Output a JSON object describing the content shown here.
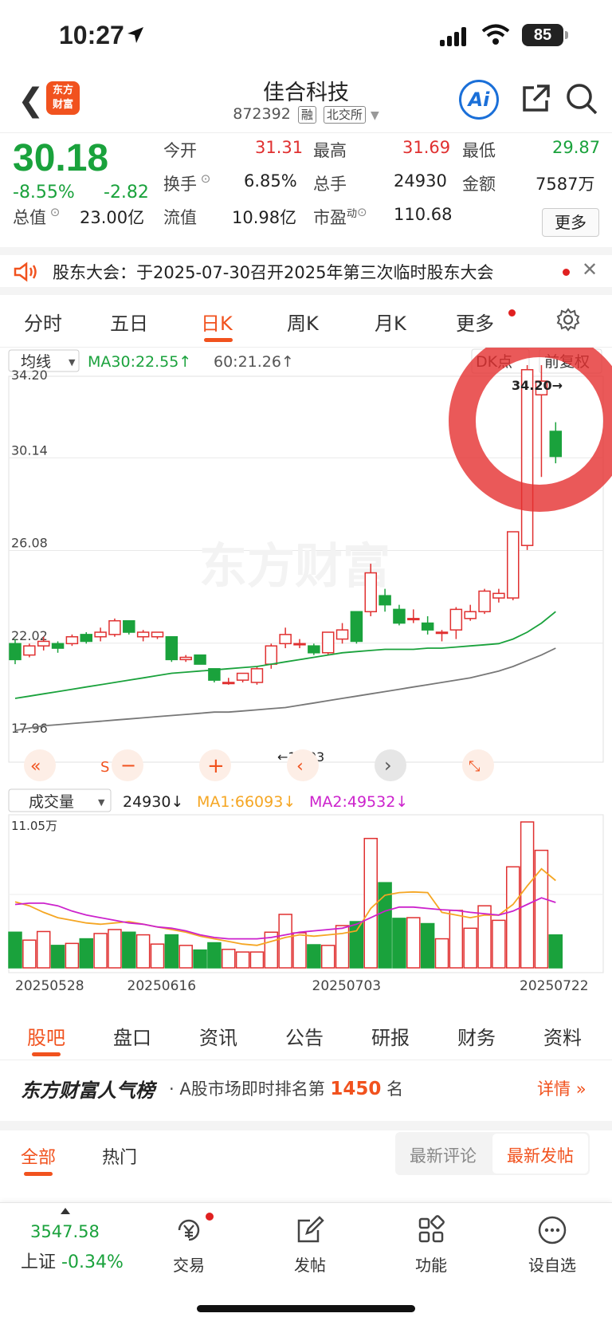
{
  "status_bar": {
    "time": "10:27",
    "battery": "85"
  },
  "header": {
    "logo_line1": "东方",
    "logo_line2": "财富",
    "title": "佳合科技",
    "code": "872392",
    "tag_margin": "融",
    "tag_exchange": "北交所"
  },
  "quote": {
    "price": "30.18",
    "change_pct": "-8.55%",
    "change": "-2.82",
    "open_label": "今开",
    "open": "31.31",
    "high_label": "最高",
    "high": "31.69",
    "low_label": "最低",
    "low": "29.87",
    "turnover_label": "换手",
    "turnover": "6.85%",
    "volume_label": "总手",
    "volume": "24930",
    "amount_label": "金额",
    "amount": "7587万",
    "mktcap_label": "总值",
    "mktcap": "23.00亿",
    "float_label": "流值",
    "float": "10.98亿",
    "pe_label": "市盈",
    "pe_sup": "动",
    "pe": "110.68",
    "more_label": "更多"
  },
  "notice": {
    "text": "股东大会：于2025-07-30召开2025年第三次临时股东大会"
  },
  "chart_tabs": [
    "分时",
    "五日",
    "日K",
    "周K",
    "月K",
    "更多"
  ],
  "active_chart_tab": "日K",
  "colors": {
    "up": "#e03030",
    "down": "#1aa23c",
    "accent": "#f1521e",
    "ma30": "#1aa23c",
    "ma60": "#777777",
    "vol_ma1": "#f5a623",
    "vol_ma2": "#cc22cc"
  },
  "kline": {
    "ma_selector": "均线",
    "ma30_label": "MA30:22.55↑",
    "ma60_label": "60:21.26↑",
    "dk_label": "DK点",
    "adjust_label": "前复权",
    "watermark": "东方财富",
    "y_ticks": [
      "34.20",
      "30.14",
      "26.08",
      "22.02",
      "17.96"
    ],
    "max_annotation": "34.20→",
    "min_annotation": "←19.03"
  },
  "volume_panel": {
    "selector": "成交量",
    "vol_label": "24930↓",
    "ma1_label": "MA1:66093↓",
    "ma2_label": "MA2:49532↓",
    "top_tick": "11.05万",
    "date_ticks": [
      "20250528",
      "20250616",
      "20250703",
      "20250722"
    ]
  },
  "chart_data": {
    "type": "candlestick",
    "ylim": [
      17.96,
      34.2
    ],
    "candles": [
      {
        "o": 22.0,
        "h": 22.2,
        "l": 21.1,
        "c": 21.3
      },
      {
        "o": 21.5,
        "h": 22.0,
        "l": 21.4,
        "c": 21.9
      },
      {
        "o": 21.9,
        "h": 22.3,
        "l": 21.7,
        "c": 22.1
      },
      {
        "o": 22.0,
        "h": 22.1,
        "l": 21.6,
        "c": 21.8
      },
      {
        "o": 22.0,
        "h": 22.4,
        "l": 21.9,
        "c": 22.3
      },
      {
        "o": 22.4,
        "h": 22.5,
        "l": 22.0,
        "c": 22.1
      },
      {
        "o": 22.3,
        "h": 22.7,
        "l": 22.1,
        "c": 22.5
      },
      {
        "o": 22.4,
        "h": 23.1,
        "l": 22.3,
        "c": 23.0
      },
      {
        "o": 23.0,
        "h": 23.0,
        "l": 22.4,
        "c": 22.5
      },
      {
        "o": 22.3,
        "h": 22.6,
        "l": 22.1,
        "c": 22.5
      },
      {
        "o": 22.3,
        "h": 22.5,
        "l": 22.2,
        "c": 22.5
      },
      {
        "o": 22.3,
        "h": 22.3,
        "l": 21.2,
        "c": 21.3
      },
      {
        "o": 21.3,
        "h": 21.5,
        "l": 21.2,
        "c": 21.4
      },
      {
        "o": 21.5,
        "h": 21.5,
        "l": 21.1,
        "c": 21.1
      },
      {
        "o": 20.9,
        "h": 20.9,
        "l": 20.3,
        "c": 20.4
      },
      {
        "o": 20.3,
        "h": 20.5,
        "l": 20.2,
        "c": 20.3
      },
      {
        "o": 20.4,
        "h": 20.7,
        "l": 20.3,
        "c": 20.7
      },
      {
        "o": 20.3,
        "h": 21.0,
        "l": 20.2,
        "c": 20.9
      },
      {
        "o": 21.1,
        "h": 22.0,
        "l": 20.9,
        "c": 21.9
      },
      {
        "o": 22.0,
        "h": 22.7,
        "l": 21.8,
        "c": 22.4
      },
      {
        "o": 22.0,
        "h": 22.2,
        "l": 21.8,
        "c": 22.0
      },
      {
        "o": 21.9,
        "h": 22.0,
        "l": 21.5,
        "c": 21.6
      },
      {
        "o": 21.6,
        "h": 22.5,
        "l": 21.5,
        "c": 22.5
      },
      {
        "o": 22.2,
        "h": 22.9,
        "l": 22.0,
        "c": 22.6
      },
      {
        "o": 23.4,
        "h": 23.4,
        "l": 22.0,
        "c": 22.1
      },
      {
        "o": 23.4,
        "h": 25.5,
        "l": 23.2,
        "c": 25.1
      },
      {
        "o": 24.1,
        "h": 24.4,
        "l": 23.4,
        "c": 23.7
      },
      {
        "o": 23.5,
        "h": 23.7,
        "l": 22.8,
        "c": 22.9
      },
      {
        "o": 23.1,
        "h": 23.5,
        "l": 22.9,
        "c": 23.1
      },
      {
        "o": 22.9,
        "h": 23.2,
        "l": 22.4,
        "c": 22.6
      },
      {
        "o": 22.5,
        "h": 22.6,
        "l": 22.1,
        "c": 22.5
      },
      {
        "o": 22.6,
        "h": 23.6,
        "l": 22.2,
        "c": 23.5
      },
      {
        "o": 23.1,
        "h": 23.7,
        "l": 23.0,
        "c": 23.4
      },
      {
        "o": 23.4,
        "h": 24.4,
        "l": 23.3,
        "c": 24.3
      },
      {
        "o": 24.0,
        "h": 24.4,
        "l": 23.8,
        "c": 24.2
      },
      {
        "o": 24.0,
        "h": 26.9,
        "l": 23.9,
        "c": 26.9
      },
      {
        "o": 26.3,
        "h": 34.2,
        "l": 26.1,
        "c": 34.0
      },
      {
        "o": 32.9,
        "h": 34.2,
        "l": 29.3,
        "c": 33.5
      },
      {
        "o": 31.3,
        "h": 31.7,
        "l": 29.9,
        "c": 30.2
      }
    ],
    "ma30": [
      19.6,
      19.7,
      19.8,
      19.9,
      20.0,
      20.1,
      20.2,
      20.3,
      20.4,
      20.5,
      20.6,
      20.7,
      20.75,
      20.8,
      20.85,
      20.9,
      20.95,
      21.0,
      21.1,
      21.2,
      21.3,
      21.4,
      21.5,
      21.6,
      21.65,
      21.7,
      21.75,
      21.75,
      21.75,
      21.8,
      21.8,
      21.85,
      21.9,
      21.95,
      22.0,
      22.2,
      22.5,
      22.9,
      23.4
    ],
    "ma60": [
      18.2,
      18.3,
      18.4,
      18.45,
      18.5,
      18.55,
      18.6,
      18.65,
      18.7,
      18.75,
      18.8,
      18.85,
      18.9,
      18.95,
      19.0,
      19.0,
      19.05,
      19.1,
      19.15,
      19.2,
      19.3,
      19.4,
      19.5,
      19.6,
      19.7,
      19.8,
      19.9,
      20.0,
      20.1,
      20.2,
      20.3,
      20.4,
      20.5,
      20.65,
      20.8,
      21.0,
      21.25,
      21.5,
      21.8
    ]
  },
  "volume_data": {
    "max": 110500,
    "values": [
      27000,
      21000,
      27500,
      17000,
      18500,
      22000,
      26000,
      29000,
      27000,
      25000,
      18000,
      25000,
      17000,
      13500,
      19000,
      14000,
      12000,
      12000,
      27000,
      40500,
      26500,
      17500,
      17000,
      32000,
      35000,
      98000,
      64500,
      37500,
      38000,
      33500,
      22000,
      43500,
      30000,
      47000,
      36000,
      76500,
      110500,
      89000,
      24930
    ],
    "ma1": [
      50000,
      47000,
      42000,
      38000,
      36000,
      34000,
      33000,
      34000,
      35000,
      33000,
      31000,
      29000,
      27000,
      24000,
      22000,
      20000,
      18000,
      17000,
      20000,
      23000,
      25000,
      24000,
      25000,
      26000,
      28000,
      45000,
      55000,
      57000,
      57500,
      57000,
      42000,
      40000,
      38000,
      40000,
      40000,
      48000,
      62000,
      75000,
      66093
    ],
    "ma2": [
      48000,
      49000,
      49000,
      47000,
      43000,
      40000,
      38000,
      36000,
      34000,
      33000,
      31000,
      30000,
      28000,
      25000,
      23000,
      22000,
      22000,
      22000,
      23000,
      25000,
      27000,
      28000,
      29000,
      30000,
      33000,
      38000,
      43000,
      46000,
      46000,
      45000,
      44000,
      43500,
      42000,
      41000,
      40000,
      43000,
      48000,
      53000,
      49532
    ]
  },
  "bottom_tabs": [
    "股吧",
    "盘口",
    "资讯",
    "公告",
    "研报",
    "财务",
    "资料"
  ],
  "ranking": {
    "brand": "东方财富人气榜",
    "prefix": "· A股市场即时排名第",
    "rank": "1450",
    "suffix": "名",
    "detail": "详情"
  },
  "feed_filter": {
    "all": "全部",
    "hot": "热门",
    "latest_comment": "最新评论",
    "latest_post": "最新发帖"
  },
  "dock": {
    "index_value": "3547.58",
    "index_name": "上证",
    "index_change": "-0.34%",
    "items": [
      "交易",
      "发帖",
      "功能",
      "设自选"
    ]
  }
}
